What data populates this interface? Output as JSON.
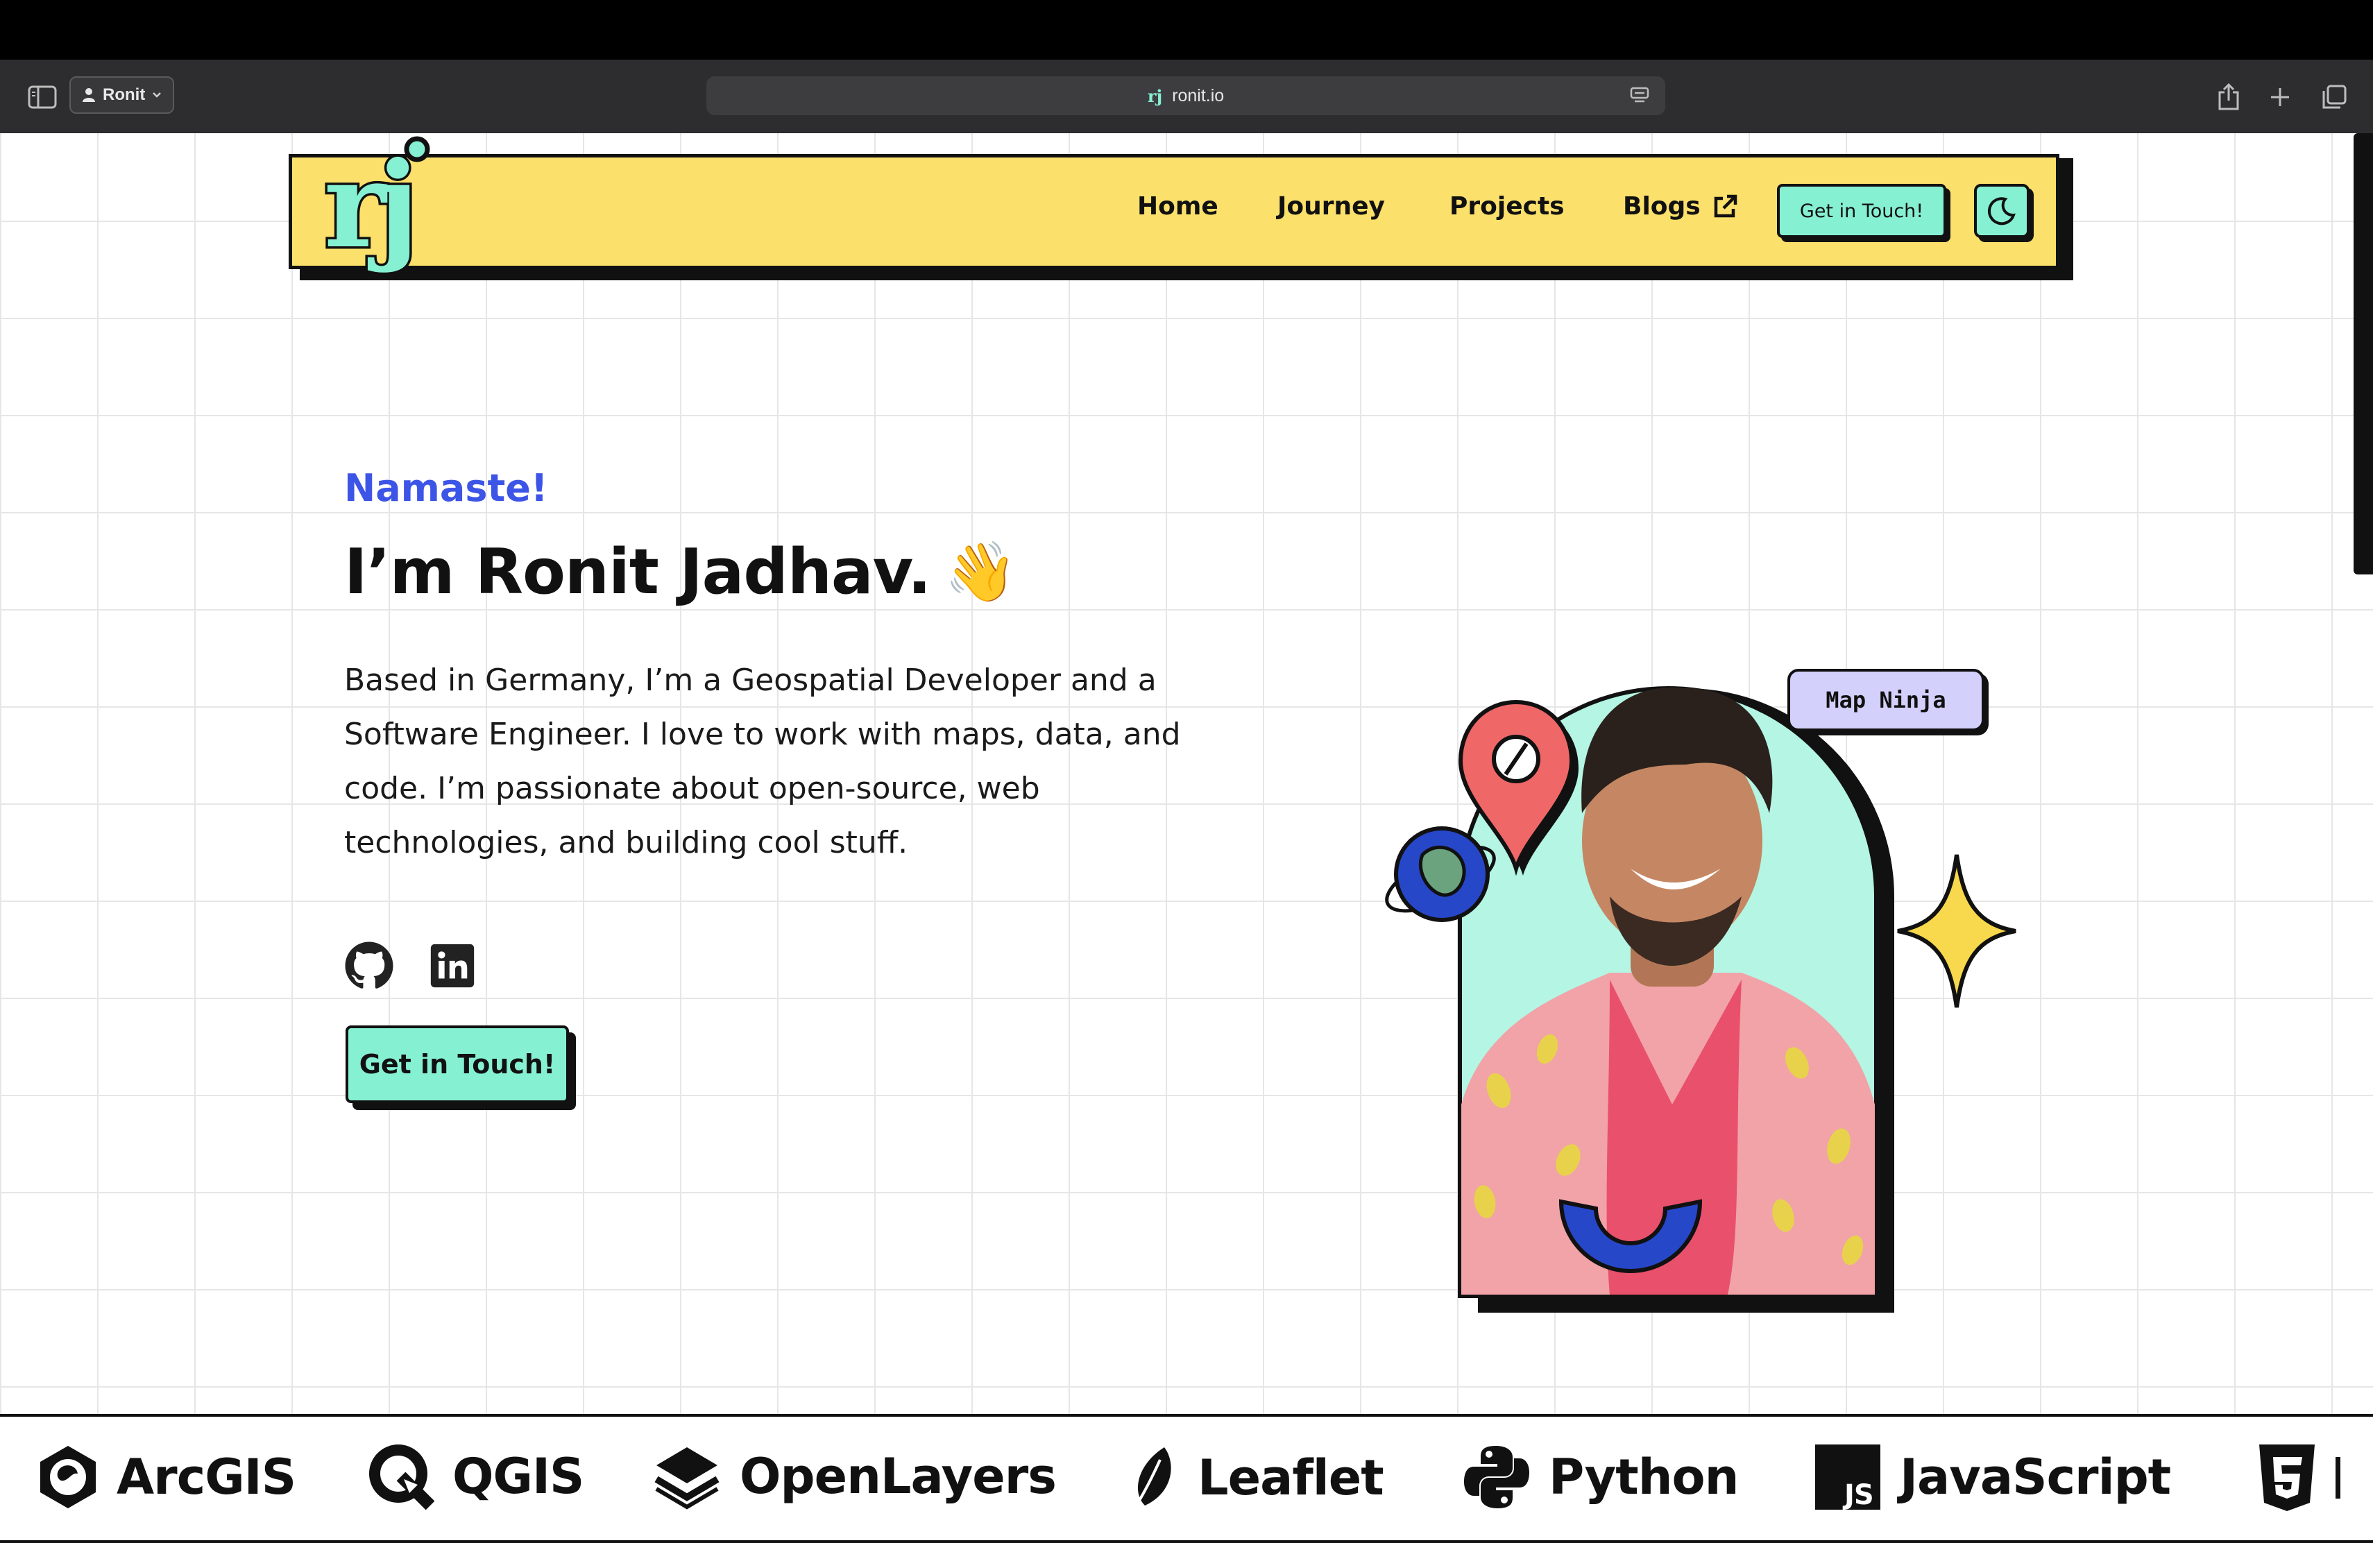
{
  "browser": {
    "profile_name": "Ronit",
    "url": "ronit.io"
  },
  "navbar": {
    "logo_text": "rj",
    "links": [
      "Home",
      "Journey",
      "Projects",
      "Blogs"
    ],
    "cta_label": "Get in Touch!"
  },
  "hero": {
    "greeting": "Namaste!",
    "headline": "I’m Ronit Jadhav.",
    "wave_emoji": "👋",
    "bio": "Based in Germany, I’m a Geospatial Developer and a Software Engineer. I love to work with maps, data, and code. I’m passionate about open-source, web technologies, and building cool stuff.",
    "cta_label": "Get in Touch!",
    "badge": "Map Ninja"
  },
  "tech_stack": [
    "ArcGIS",
    "QGIS",
    "OpenLayers",
    "Leaflet",
    "Python",
    "JavaScript"
  ],
  "colors": {
    "navbar_bg": "#fbe06b",
    "accent_mint": "#86f0d2",
    "greeting_blue": "#3d55e6",
    "badge_lavender": "#d3d1fb",
    "ink": "#111111"
  }
}
